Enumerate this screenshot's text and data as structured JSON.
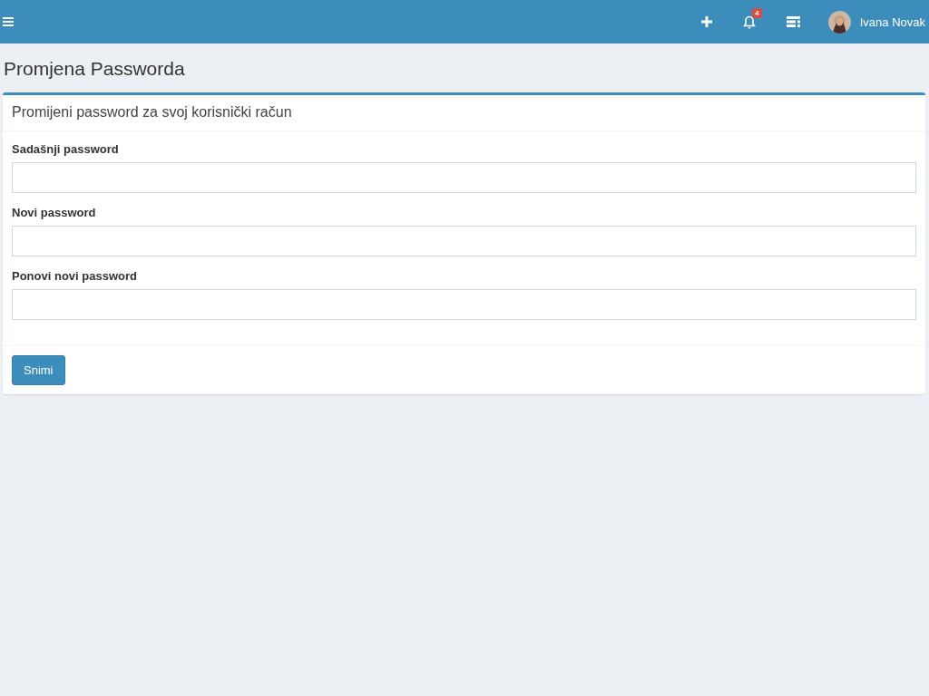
{
  "navbar": {
    "notifications_badge": "4",
    "user_name": "Ivana Novak"
  },
  "page_title": "Promjena Passworda",
  "form": {
    "title": "Promijeni password za svoj korisnički račun",
    "fields": [
      {
        "label": "Sadašnji password"
      },
      {
        "label": "Novi password"
      },
      {
        "label": "Ponovi novi password"
      }
    ],
    "submit": "Snimi"
  }
}
